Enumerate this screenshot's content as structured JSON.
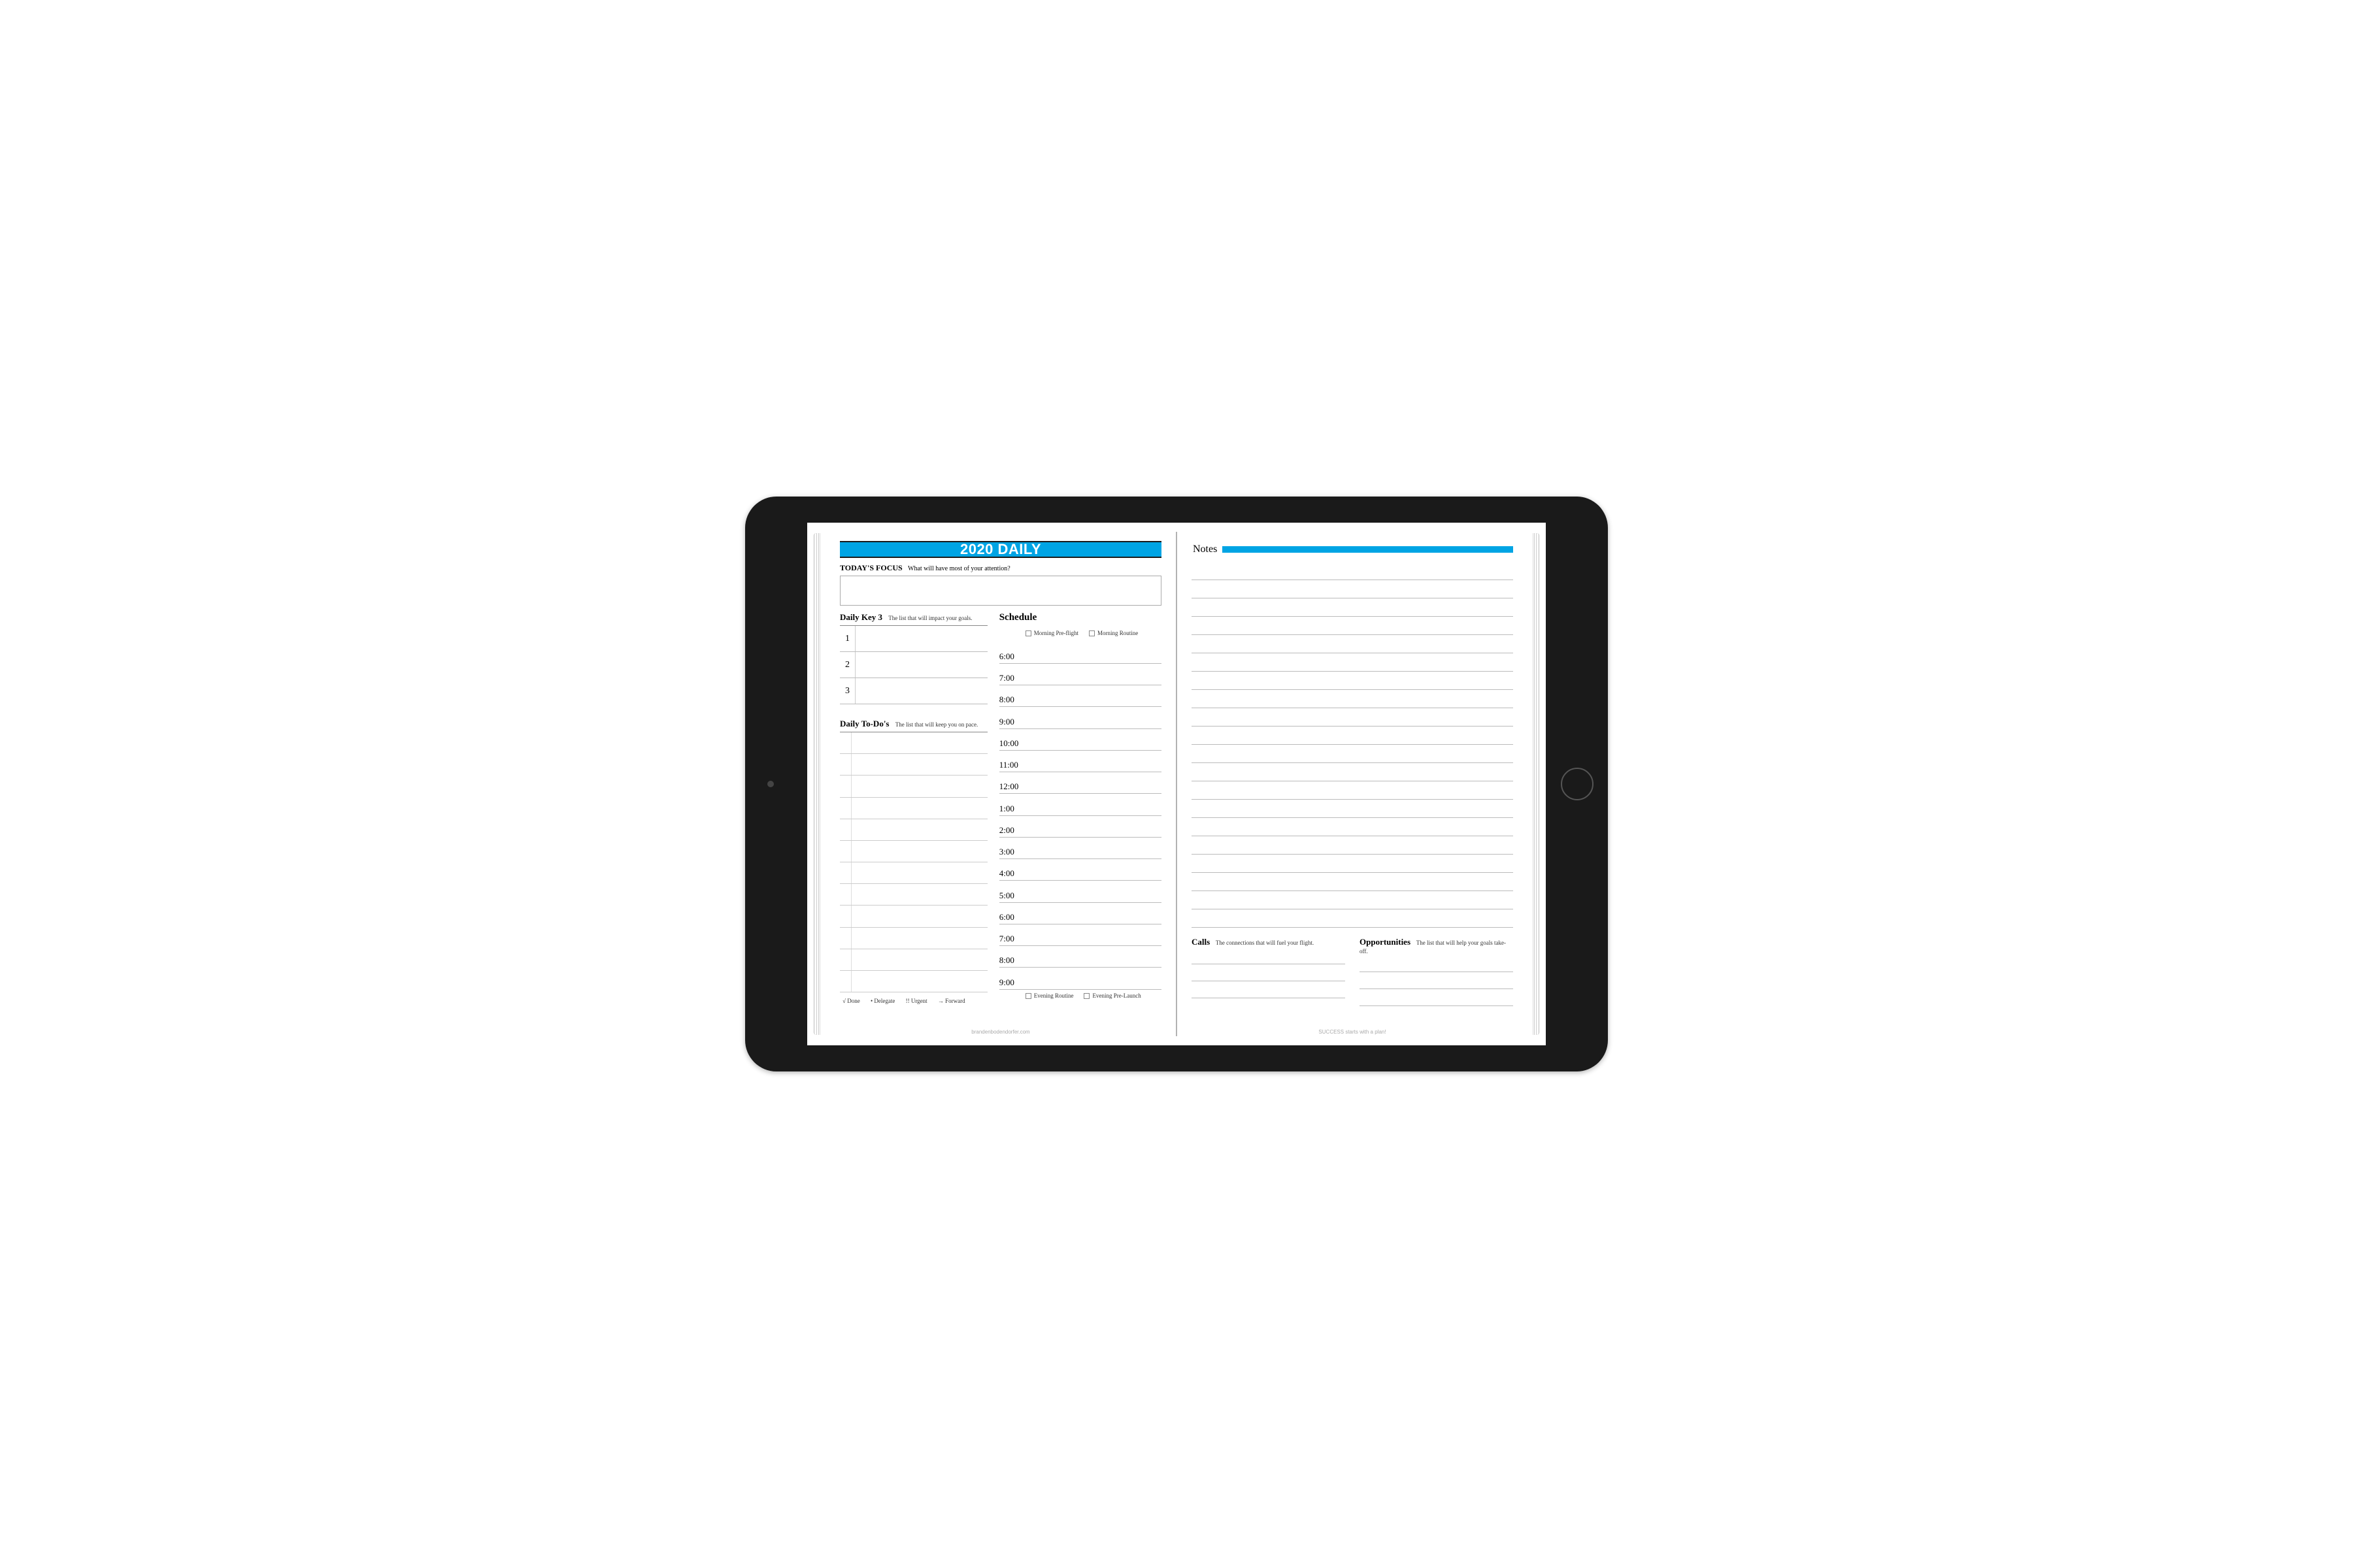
{
  "header": {
    "title": "2020 DAILY"
  },
  "focus": {
    "label": "TODAY'S FOCUS",
    "prompt": "What will have most of your attention?"
  },
  "key3": {
    "label": "Daily Key 3",
    "sub": "The list that will impact your goals.",
    "nums": [
      "1",
      "2",
      "3"
    ]
  },
  "todo": {
    "label": "Daily To-Do's",
    "sub": "The list that will keep you on pace.",
    "row_count": 12
  },
  "legend": {
    "done": "√ Done",
    "delegate": "• Delegate",
    "urgent": "!! Urgent",
    "forward": "→ Forward"
  },
  "schedule": {
    "label": "Schedule",
    "top_checks": [
      "Morning Pre-flight",
      "Morning Routine"
    ],
    "hours": [
      "6:00",
      "7:00",
      "8:00",
      "9:00",
      "10:00",
      "11:00",
      "12:00",
      "1:00",
      "2:00",
      "3:00",
      "4:00",
      "5:00",
      "6:00",
      "7:00",
      "8:00",
      "9:00"
    ],
    "bottom_checks": [
      "Evening Routine",
      "Evening Pre-Launch"
    ]
  },
  "notes": {
    "label": "Notes",
    "line_count": 20
  },
  "calls": {
    "label": "Calls",
    "sub": "The connections that will fuel your flight.",
    "line_count": 3
  },
  "opps": {
    "label": "Opportunities",
    "sub": "The list that will help your goals take-off.",
    "line_count": 3
  },
  "footer": {
    "left": "brandenbodendorfer.com",
    "right": "SUCCESS starts with a plan!"
  }
}
